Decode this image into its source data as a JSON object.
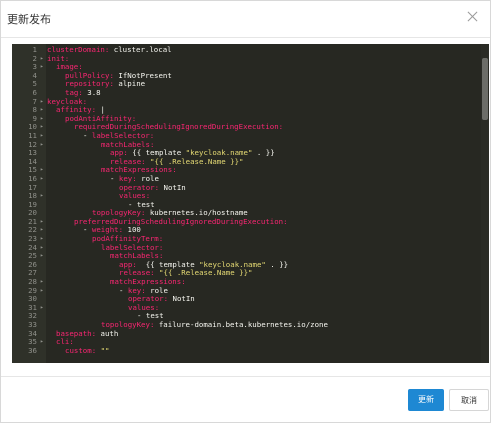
{
  "dialog": {
    "title": "更新发布",
    "close_icon": "close-icon"
  },
  "editor": {
    "lines": [
      {
        "n": "1",
        "fold": "",
        "indent": 0,
        "parts": [
          [
            "k",
            "clusterDomain: "
          ],
          [
            "v",
            "cluster.local"
          ]
        ]
      },
      {
        "n": "2",
        "fold": "▸",
        "indent": 0,
        "parts": [
          [
            "k",
            "init:"
          ]
        ]
      },
      {
        "n": "3",
        "fold": "▸",
        "indent": 1,
        "parts": [
          [
            "k",
            "image:"
          ]
        ]
      },
      {
        "n": "4",
        "fold": "",
        "indent": 2,
        "parts": [
          [
            "k",
            "pullPolicy: "
          ],
          [
            "v",
            "IfNotPresent"
          ]
        ]
      },
      {
        "n": "5",
        "fold": "",
        "indent": 2,
        "parts": [
          [
            "k",
            "repository: "
          ],
          [
            "v",
            "alpine"
          ]
        ]
      },
      {
        "n": "6",
        "fold": "",
        "indent": 2,
        "parts": [
          [
            "k",
            "tag: "
          ],
          [
            "v",
            "3.8"
          ]
        ]
      },
      {
        "n": "7",
        "fold": "▸",
        "indent": 0,
        "parts": [
          [
            "k",
            "keycloak:"
          ]
        ]
      },
      {
        "n": "8",
        "fold": "▸",
        "indent": 1,
        "parts": [
          [
            "k",
            "affinity: "
          ],
          [
            "v",
            "|"
          ]
        ]
      },
      {
        "n": "9",
        "fold": "▸",
        "indent": 2,
        "parts": [
          [
            "k",
            "podAntiAffinity:"
          ]
        ]
      },
      {
        "n": "10",
        "fold": "▸",
        "indent": 3,
        "parts": [
          [
            "k",
            "requiredDuringSchedulingIgnoredDuringExecution:"
          ]
        ]
      },
      {
        "n": "11",
        "fold": "▸",
        "indent": 4,
        "parts": [
          [
            "v",
            "- "
          ],
          [
            "k",
            "labelSelector:"
          ]
        ]
      },
      {
        "n": "12",
        "fold": "▸",
        "indent": 6,
        "parts": [
          [
            "k",
            "matchLabels:"
          ]
        ]
      },
      {
        "n": "13",
        "fold": "",
        "indent": 7,
        "parts": [
          [
            "k",
            "app: "
          ],
          [
            "v",
            "{{ template "
          ],
          [
            "s",
            "\"keycloak.name\""
          ],
          [
            "v",
            " . }}"
          ]
        ]
      },
      {
        "n": "14",
        "fold": "",
        "indent": 7,
        "parts": [
          [
            "k",
            "release: "
          ],
          [
            "s",
            "\"{{ .Release.Name }}\""
          ]
        ]
      },
      {
        "n": "15",
        "fold": "▸",
        "indent": 6,
        "parts": [
          [
            "k",
            "matchExpressions:"
          ]
        ]
      },
      {
        "n": "16",
        "fold": "▸",
        "indent": 7,
        "parts": [
          [
            "v",
            "- "
          ],
          [
            "k",
            "key: "
          ],
          [
            "v",
            "role"
          ]
        ]
      },
      {
        "n": "17",
        "fold": "",
        "indent": 8,
        "parts": [
          [
            "k",
            "operator: "
          ],
          [
            "v",
            "NotIn"
          ]
        ]
      },
      {
        "n": "18",
        "fold": "▸",
        "indent": 8,
        "parts": [
          [
            "k",
            "values:"
          ]
        ]
      },
      {
        "n": "19",
        "fold": "",
        "indent": 9,
        "parts": [
          [
            "v",
            "- test"
          ]
        ]
      },
      {
        "n": "20",
        "fold": "",
        "indent": 5,
        "parts": [
          [
            "k",
            "topologyKey: "
          ],
          [
            "v",
            "kubernetes.io/hostname"
          ]
        ]
      },
      {
        "n": "21",
        "fold": "▸",
        "indent": 3,
        "parts": [
          [
            "k",
            "preferredDuringSchedulingIgnoredDuringExecution:"
          ]
        ]
      },
      {
        "n": "22",
        "fold": "▸",
        "indent": 4,
        "parts": [
          [
            "v",
            "- "
          ],
          [
            "k",
            "weight: "
          ],
          [
            "v",
            "100"
          ]
        ]
      },
      {
        "n": "23",
        "fold": "▸",
        "indent": 5,
        "parts": [
          [
            "k",
            "podAffinityTerm:"
          ]
        ]
      },
      {
        "n": "24",
        "fold": "▸",
        "indent": 6,
        "parts": [
          [
            "k",
            "labelSelector:"
          ]
        ]
      },
      {
        "n": "25",
        "fold": "▸",
        "indent": 7,
        "parts": [
          [
            "k",
            "matchLabels:"
          ]
        ]
      },
      {
        "n": "26",
        "fold": "",
        "indent": 8,
        "parts": [
          [
            "k",
            "app:  "
          ],
          [
            "v",
            "{{ template "
          ],
          [
            "s",
            "\"keycloak.name\""
          ],
          [
            "v",
            " . }}"
          ]
        ]
      },
      {
        "n": "27",
        "fold": "",
        "indent": 8,
        "parts": [
          [
            "k",
            "release: "
          ],
          [
            "s",
            "\"{{ .Release.Name }}\""
          ]
        ]
      },
      {
        "n": "28",
        "fold": "▸",
        "indent": 7,
        "parts": [
          [
            "k",
            "matchExpressions:"
          ]
        ]
      },
      {
        "n": "29",
        "fold": "▸",
        "indent": 8,
        "parts": [
          [
            "v",
            "- "
          ],
          [
            "k",
            "key: "
          ],
          [
            "v",
            "role"
          ]
        ]
      },
      {
        "n": "30",
        "fold": "",
        "indent": 9,
        "parts": [
          [
            "k",
            "operator: "
          ],
          [
            "v",
            "NotIn"
          ]
        ]
      },
      {
        "n": "31",
        "fold": "▸",
        "indent": 9,
        "parts": [
          [
            "k",
            "values:"
          ]
        ]
      },
      {
        "n": "32",
        "fold": "",
        "indent": 10,
        "parts": [
          [
            "v",
            "- test"
          ]
        ]
      },
      {
        "n": "33",
        "fold": "",
        "indent": 6,
        "parts": [
          [
            "k",
            "topologyKey: "
          ],
          [
            "v",
            "failure-domain.beta.kubernetes.io/zone"
          ]
        ]
      },
      {
        "n": "34",
        "fold": "",
        "indent": 1,
        "parts": [
          [
            "k",
            "basepath: "
          ],
          [
            "v",
            "auth"
          ]
        ]
      },
      {
        "n": "35",
        "fold": "▸",
        "indent": 1,
        "parts": [
          [
            "k",
            "cli:"
          ]
        ]
      },
      {
        "n": "36",
        "fold": "",
        "indent": 2,
        "parts": [
          [
            "k",
            "custom: "
          ],
          [
            "s",
            "\"\""
          ]
        ]
      }
    ]
  },
  "footer": {
    "update_label": "更新",
    "cancel_label": "取消"
  },
  "colors": {
    "primary_button": "#1e88d3",
    "editor_background": "#272822",
    "yaml_key": "#f92672",
    "yaml_string": "#e6db74"
  }
}
